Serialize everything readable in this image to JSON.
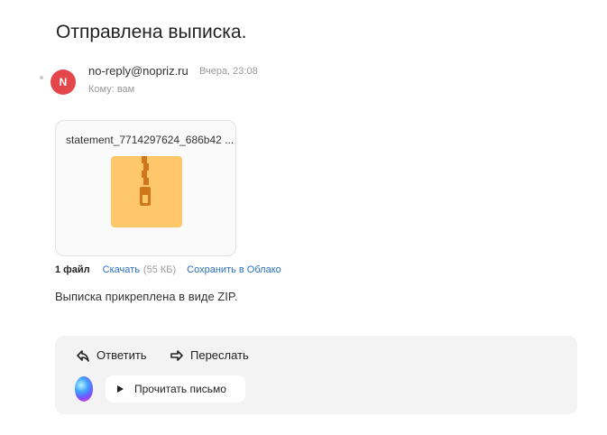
{
  "mail": {
    "subject": "Отправлена выписка.",
    "sender_initial": "N",
    "sender": "no-reply@nopriz.ru",
    "date": "Вчера, 23:08",
    "to": "Кому: вам"
  },
  "attachment": {
    "filename": "statement_7714297624_686b42 ...",
    "icon": "zip-archive-icon",
    "count_label": "1 файл",
    "download_label": "Скачать",
    "download_size": "(55 КБ)",
    "cloud_label": "Сохранить в Облако"
  },
  "body": {
    "text": "Выписка прикреплена в виде ZIP."
  },
  "actions": {
    "reply_label": "Ответить",
    "forward_label": "Переслать",
    "read_label": "Прочитать письмо"
  },
  "colors": {
    "avatar": "#e3474b",
    "link": "#2b6fc0",
    "zip_folder": "#fec86a",
    "zip_zipper": "#d0771c"
  }
}
